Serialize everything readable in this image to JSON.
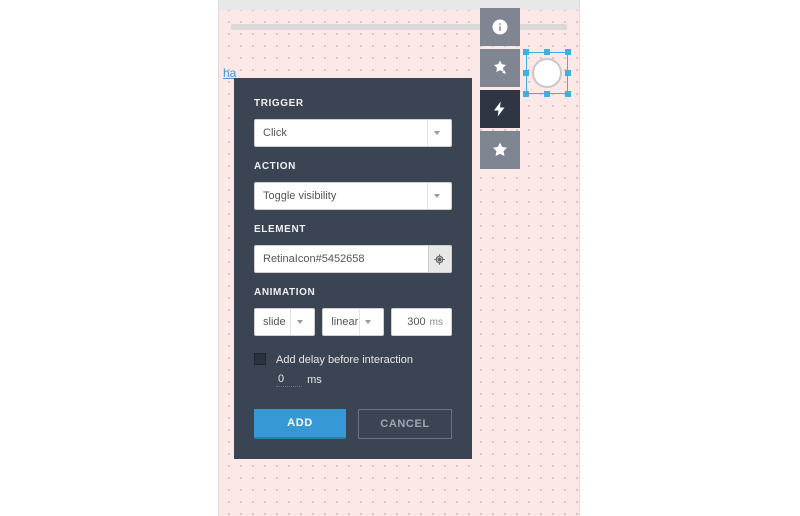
{
  "canvas": {
    "link_text": "ha"
  },
  "toolbar": {
    "items": [
      {
        "name": "info-icon"
      },
      {
        "name": "styles-icon"
      },
      {
        "name": "interactions-icon"
      },
      {
        "name": "star-icon"
      }
    ]
  },
  "panel": {
    "trigger": {
      "label": "TRIGGER",
      "value": "Click"
    },
    "action": {
      "label": "ACTION",
      "value": "Toggle visibility"
    },
    "element": {
      "label": "ELEMENT",
      "value": "RetinaIcon#5452658"
    },
    "animation": {
      "label": "ANIMATION",
      "type": "slide",
      "easing": "linear",
      "duration": "300",
      "unit": "ms"
    },
    "delay": {
      "label": "Add delay before interaction",
      "value": "0",
      "unit": "ms"
    },
    "buttons": {
      "add": "ADD",
      "cancel": "CANCEL"
    }
  }
}
